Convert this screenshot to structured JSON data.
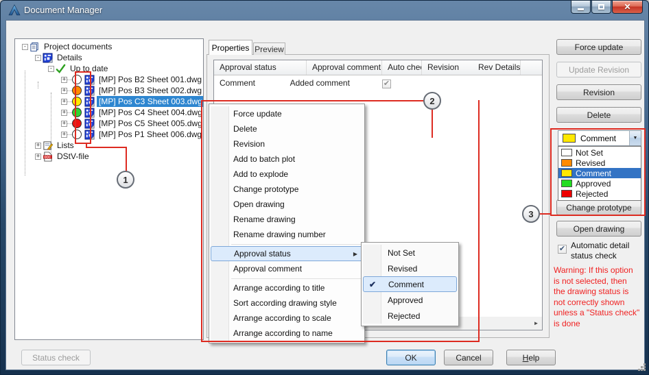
{
  "window": {
    "title": "Document Manager"
  },
  "icons": {
    "checkmark": "✔",
    "menu_arrow": "▶",
    "combo_arrow": "▼",
    "scroll_left": "◄",
    "scroll_right": "►",
    "close": "✕",
    "minus": "-",
    "plus": "+"
  },
  "tree": {
    "rows": [
      {
        "level": 0,
        "expand": "-",
        "icon": "pages",
        "label": "Project documents"
      },
      {
        "level": 1,
        "expand": "-",
        "icon": "details",
        "label": "Details"
      },
      {
        "level": 2,
        "expand": "-",
        "icon": "check",
        "label": "Up to date"
      },
      {
        "level": 3,
        "expand": "+",
        "circle": "#ffffff",
        "icon": "details",
        "label": "[MP] Pos B2 Sheet 001.dwg"
      },
      {
        "level": 3,
        "expand": "+",
        "circle": "#ff8a00",
        "icon": "details",
        "label": "[MP] Pos B3 Sheet 002.dwg"
      },
      {
        "level": 3,
        "expand": "+",
        "circle": "#ffe800",
        "icon": "details",
        "label": "[MP] Pos C3 Sheet 003.dwg",
        "selected": true
      },
      {
        "level": 3,
        "expand": "+",
        "circle": "#2fd32f",
        "icon": "details",
        "label": "[MP] Pos C4 Sheet 004.dwg"
      },
      {
        "level": 3,
        "expand": "+",
        "circle": "#ee1111",
        "icon": "details",
        "label": "[MP] Pos C5 Sheet 005.dwg"
      },
      {
        "level": 3,
        "expand": "+",
        "circle": "#ffffff",
        "icon": "details",
        "label": "[MP] Pos P1 Sheet 006.dwg"
      },
      {
        "level": 1,
        "expand": "+",
        "icon": "lists",
        "label": "Lists"
      },
      {
        "level": 1,
        "expand": "+",
        "icon": "doc",
        "label": "DStV-file"
      }
    ]
  },
  "tabs": {
    "properties": "Properties",
    "preview": "Preview"
  },
  "grid": {
    "columns": [
      {
        "label": "Approval status"
      },
      {
        "label": "Approval comment"
      },
      {
        "label": "Auto check status"
      },
      {
        "label": "Revision"
      },
      {
        "label": "Rev Details"
      }
    ],
    "row": {
      "approval_status": "Comment",
      "approval_comment": "Added comment",
      "auto_check_checked": true,
      "revision": "",
      "rev_details": ""
    }
  },
  "menu": {
    "items": [
      {
        "label": "Force update"
      },
      {
        "label": "Delete"
      },
      {
        "label": "Revision"
      },
      {
        "label": "Add to batch plot"
      },
      {
        "label": "Add to explode"
      },
      {
        "label": "Change prototype"
      },
      {
        "label": "Open drawing"
      },
      {
        "label": "Rename drawing"
      },
      {
        "label": "Rename drawing number"
      },
      {
        "type": "separator"
      },
      {
        "label": "Approval status",
        "arrow": true,
        "highlighted": true
      },
      {
        "label": "Approval comment"
      },
      {
        "type": "separator"
      },
      {
        "label": "Arrange according to title"
      },
      {
        "label": "Sort according drawing style"
      },
      {
        "label": "Arrange according to scale"
      },
      {
        "label": "Arrange according to name"
      }
    ]
  },
  "submenu": {
    "items": [
      {
        "label": "Not Set"
      },
      {
        "label": "Revised"
      },
      {
        "label": "Comment",
        "checked": true,
        "highlighted": true
      },
      {
        "label": "Approved"
      },
      {
        "label": "Rejected"
      }
    ]
  },
  "side": {
    "force_update": "Force update",
    "update_revision": "Update Revision",
    "revision": "Revision",
    "delete": "Delete",
    "status_combo": {
      "value": "Comment",
      "value_color": "#ffe800",
      "options": [
        {
          "label": "Not Set",
          "color": "#ffffff"
        },
        {
          "label": "Revised",
          "color": "#ff8a00"
        },
        {
          "label": "Comment",
          "color": "#ffe800",
          "selected": true
        },
        {
          "label": "Approved",
          "color": "#22dd22"
        },
        {
          "label": "Rejected",
          "color": "#ee0000"
        }
      ]
    },
    "change_prototype": "Change prototype",
    "open_drawing": "Open drawing",
    "auto_check_label": "Automatic detail\nstatus check",
    "auto_check_checked": true,
    "warning": "Warning: If this option\nis not selected, then\nthe drawing status is\nnot correctly shown\nunless a \"Status check\"\nis done"
  },
  "footer": {
    "status_check": "Status check",
    "ok": "OK",
    "cancel": "Cancel",
    "help_first": "H",
    "help_rest": "elp"
  },
  "callouts": {
    "one": "1",
    "two": "2",
    "three": "3"
  }
}
